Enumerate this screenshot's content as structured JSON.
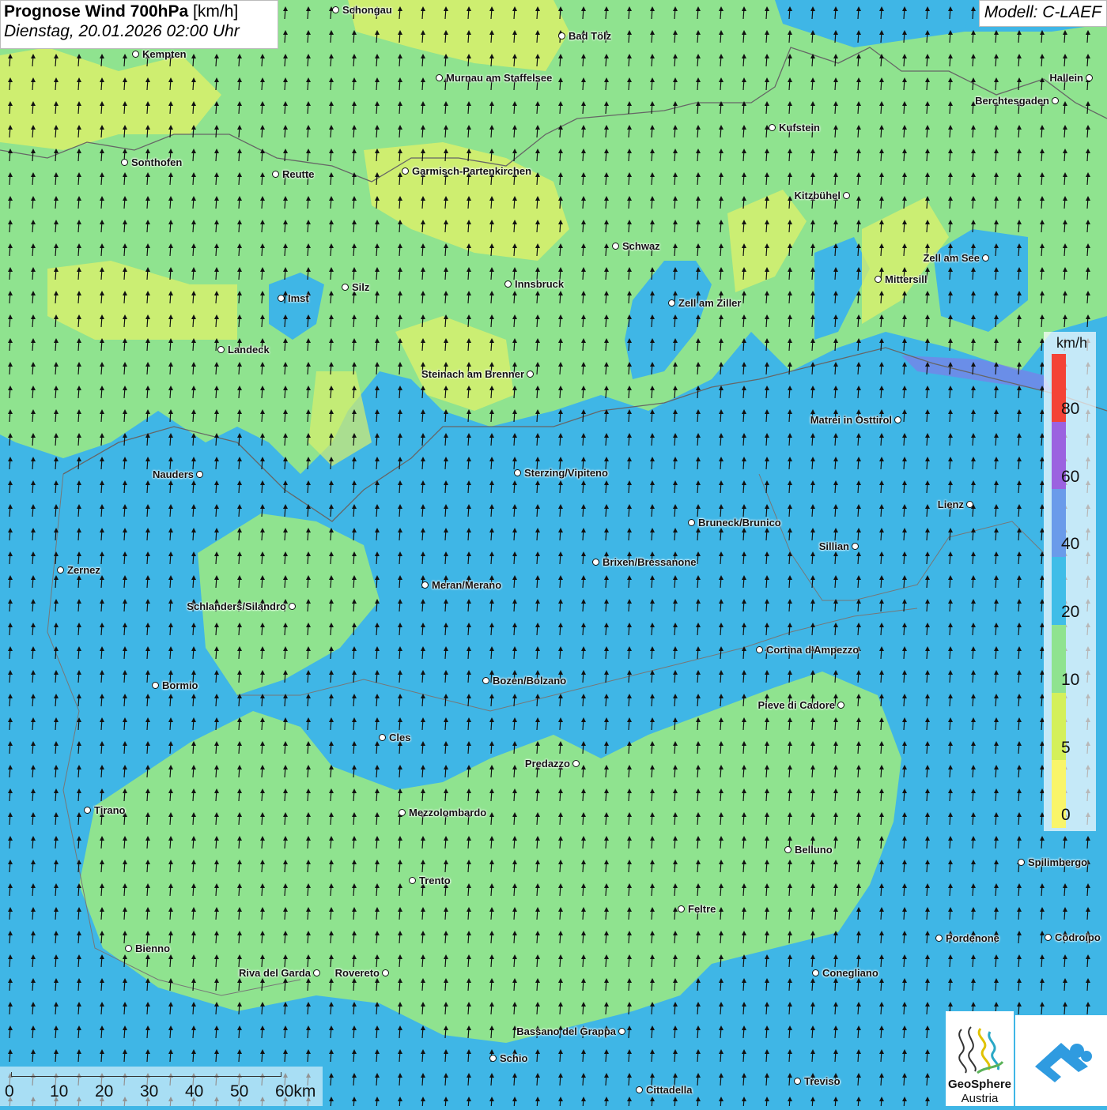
{
  "header": {
    "title_bold": "Prognose Wind 700hPa",
    "title_unit": "[km/h]",
    "datetime": "Dienstag, 20.01.2026 02:00 Uhr",
    "model": "Modell: C-LAEF"
  },
  "legend": {
    "unit": "km/h",
    "labels": [
      "80",
      "60",
      "40",
      "20",
      "10",
      "5",
      "0"
    ],
    "colors": [
      "#f44336",
      "#9b62e0",
      "#6a9bea",
      "#3fbde8",
      "#8fe38f",
      "#d4f05a",
      "#f9f56a"
    ]
  },
  "scale_bar": {
    "labels": [
      "0",
      "10",
      "20",
      "30",
      "40",
      "50",
      "60km"
    ]
  },
  "logos": {
    "geosphere_line1": "GeoSphere",
    "geosphere_line2": "Austria"
  },
  "cities": [
    {
      "name": "Schongau",
      "label_side": "right"
    },
    {
      "name": "Bad Tölz",
      "label_side": "right"
    },
    {
      "name": "Kempten",
      "label_side": "right"
    },
    {
      "name": "Murnau am Staffelsee",
      "label_side": "right"
    },
    {
      "name": "Hallein",
      "label_side": "left"
    },
    {
      "name": "Berchtesgaden",
      "label_side": "left"
    },
    {
      "name": "Kufstein",
      "label_side": "right"
    },
    {
      "name": "Sonthofen",
      "label_side": "right"
    },
    {
      "name": "Reutte",
      "label_side": "right"
    },
    {
      "name": "Garmisch-Partenkirchen",
      "label_side": "right"
    },
    {
      "name": "Kitzbühel",
      "label_side": "left"
    },
    {
      "name": "Schwaz",
      "label_side": "right"
    },
    {
      "name": "Zell am See",
      "label_side": "left"
    },
    {
      "name": "Mittersill",
      "label_side": "right"
    },
    {
      "name": "Imst",
      "label_side": "right"
    },
    {
      "name": "Silz",
      "label_side": "right"
    },
    {
      "name": "Innsbruck",
      "label_side": "right"
    },
    {
      "name": "Zell am Ziller",
      "label_side": "right"
    },
    {
      "name": "Landeck",
      "label_side": "right"
    },
    {
      "name": "Steinach am Brenner",
      "label_side": "left"
    },
    {
      "name": "Matrei in Osttirol",
      "label_side": "left"
    },
    {
      "name": "Nauders",
      "label_side": "left"
    },
    {
      "name": "Sterzing/Vipiteno",
      "label_side": "right"
    },
    {
      "name": "Lienz",
      "label_side": "left"
    },
    {
      "name": "Bruneck/Brunico",
      "label_side": "right"
    },
    {
      "name": "Sillian",
      "label_side": "left"
    },
    {
      "name": "Zernez",
      "label_side": "right"
    },
    {
      "name": "Brixen/Bressanone",
      "label_side": "right"
    },
    {
      "name": "Meran/Merano",
      "label_side": "right"
    },
    {
      "name": "Schlanders/Silandro",
      "label_side": "left"
    },
    {
      "name": "Cortina d'Ampezzo",
      "label_side": "right"
    },
    {
      "name": "Bozen/Bolzano",
      "label_side": "right"
    },
    {
      "name": "Bormio",
      "label_side": "right"
    },
    {
      "name": "Pieve di Cadore",
      "label_side": "left"
    },
    {
      "name": "Cles",
      "label_side": "right"
    },
    {
      "name": "Predazzo",
      "label_side": "left"
    },
    {
      "name": "Tirano",
      "label_side": "right"
    },
    {
      "name": "Mezzolombardo",
      "label_side": "right"
    },
    {
      "name": "Belluno",
      "label_side": "right"
    },
    {
      "name": "Spilimbergo",
      "label_side": "right"
    },
    {
      "name": "Trento",
      "label_side": "right"
    },
    {
      "name": "Feltre",
      "label_side": "right"
    },
    {
      "name": "Pordenone",
      "label_side": "right"
    },
    {
      "name": "Codroipo",
      "label_side": "right"
    },
    {
      "name": "Bienno",
      "label_side": "right"
    },
    {
      "name": "Riva del Garda",
      "label_side": "left"
    },
    {
      "name": "Rovereto",
      "label_side": "left"
    },
    {
      "name": "Conegliano",
      "label_side": "right"
    },
    {
      "name": "Bassano del Grappa",
      "label_side": "left"
    },
    {
      "name": "Schio",
      "label_side": "right"
    },
    {
      "name": "Treviso",
      "label_side": "right"
    },
    {
      "name": "Cittadella",
      "label_side": "right"
    }
  ]
}
